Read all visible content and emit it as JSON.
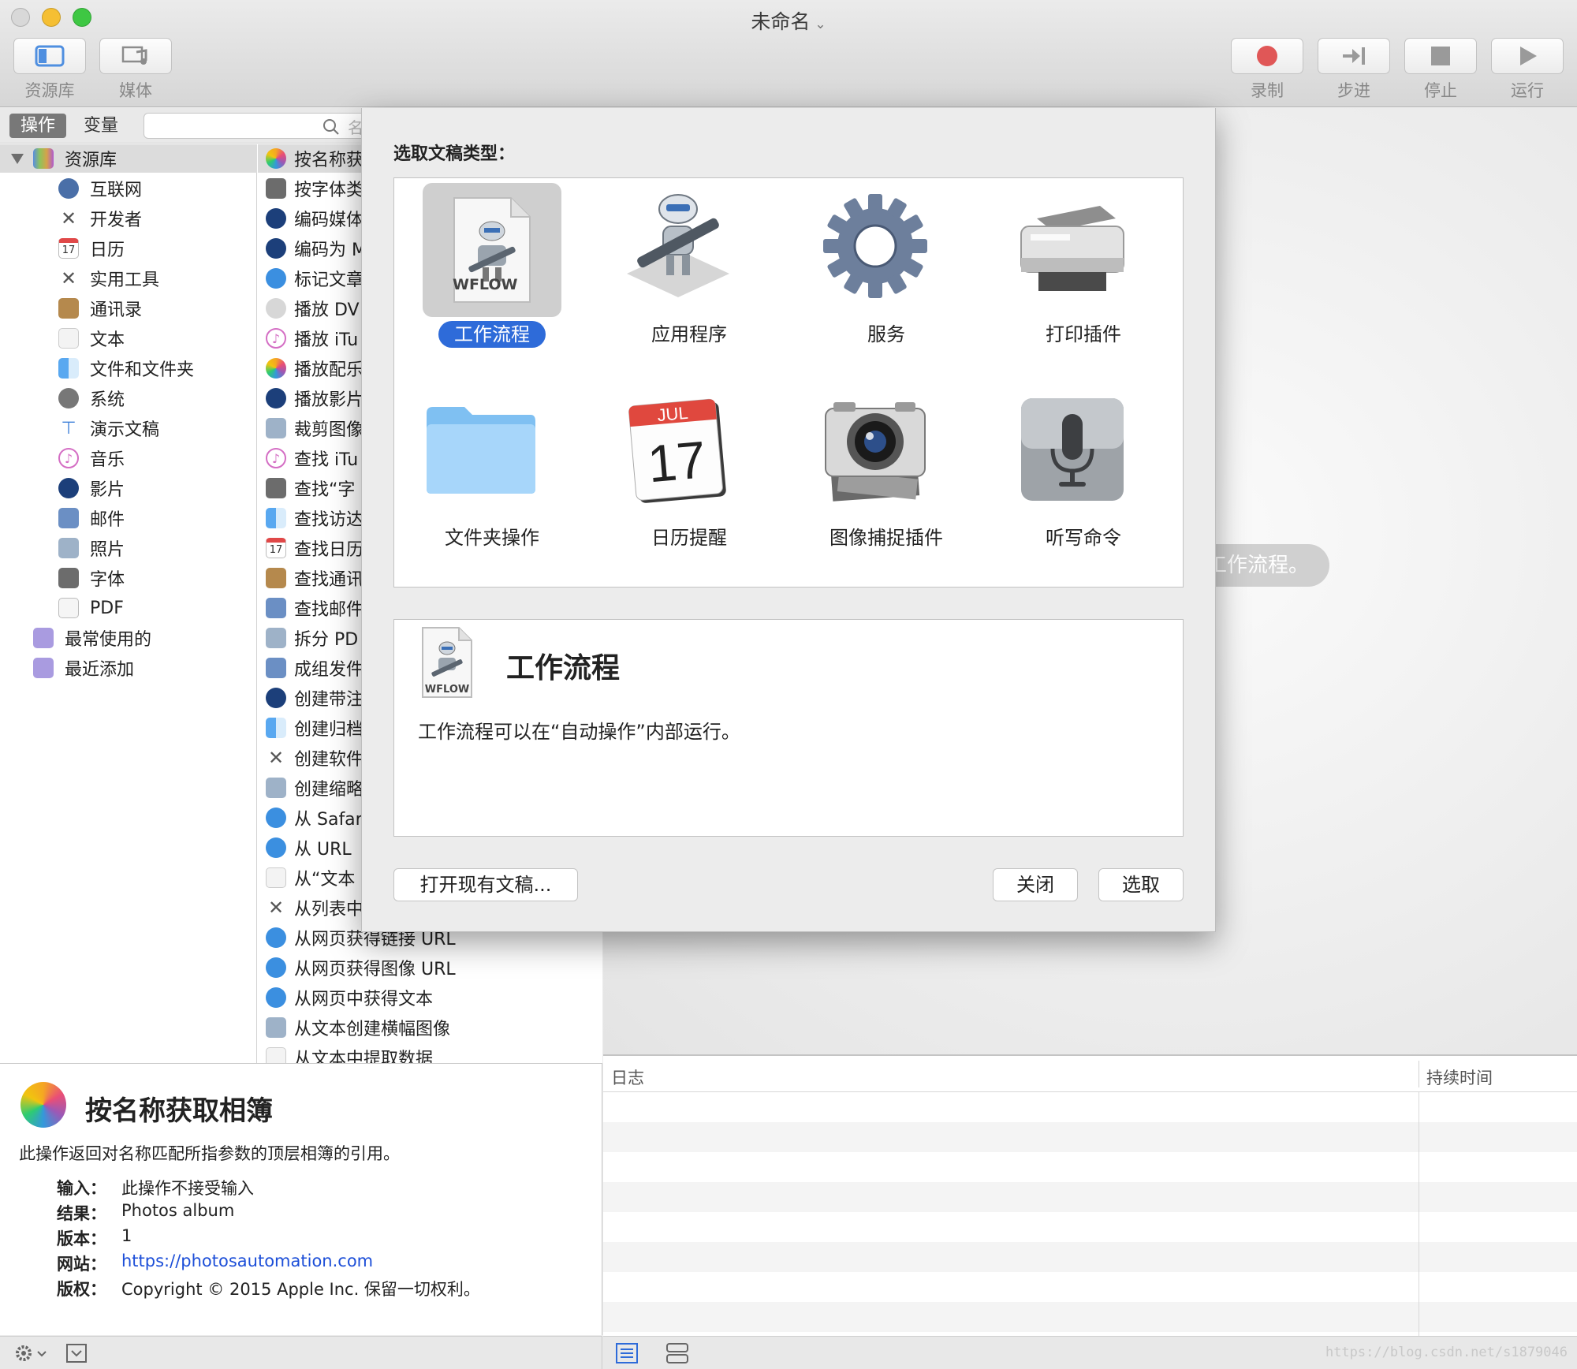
{
  "window": {
    "title": "未命名",
    "chevron": "⌄"
  },
  "toolbar": {
    "left": [
      {
        "label": "资源库",
        "icon": "library-icon"
      },
      {
        "label": "媒体",
        "icon": "media-icon"
      }
    ],
    "right": [
      {
        "label": "录制",
        "icon": "record-icon"
      },
      {
        "label": "步进",
        "icon": "step-icon"
      },
      {
        "label": "停止",
        "icon": "stop-icon"
      },
      {
        "label": "运行",
        "icon": "run-icon"
      }
    ]
  },
  "leftpane": {
    "segments": [
      "操作",
      "变量"
    ],
    "search_placeholder": "名称"
  },
  "library": {
    "root": "资源库",
    "items": [
      "互联网",
      "开发者",
      "日历",
      "实用工具",
      "通讯录",
      "文本",
      "文件和文件夹",
      "系统",
      "演示文稿",
      "音乐",
      "影片",
      "邮件",
      "照片",
      "字体",
      "PDF"
    ],
    "smart_groups": [
      "最常使用的",
      "最近添加"
    ]
  },
  "actions": {
    "items": [
      "按名称获取相簿",
      "按字体类",
      "编码媒体",
      "编码为 M",
      "标记文章",
      "播放 DV",
      "播放 iTu",
      "播放配乐",
      "播放影片",
      "裁剪图像",
      "查找 iTu",
      "查找“字",
      "查找访达",
      "查找日历",
      "查找通讯",
      "查找邮件",
      "拆分 PD",
      "成组发件",
      "创建带注",
      "创建归档",
      "创建软件",
      "创建缩略",
      "从 Safari",
      "从 URL",
      "从“文本",
      "从列表中",
      "从网页获得链接 URL",
      "从网页获得图像 URL",
      "从网页中获得文本",
      "从文本创建横幅图像",
      "从文本中提取数据"
    ]
  },
  "description": {
    "title": "按名称获取相簿",
    "text": "此操作返回对名称匹配所指参数的顶层相簿的引用。",
    "fields": [
      {
        "key": "输入：",
        "value": "此操作不接受输入"
      },
      {
        "key": "结果：",
        "value": "Photos album"
      },
      {
        "key": "版本：",
        "value": "1"
      },
      {
        "key": "网站：",
        "value": "https://photosautomation.com"
      },
      {
        "key": "版权：",
        "value": "Copyright © 2015 Apple Inc. 保留一切权利。"
      }
    ]
  },
  "workflow": {
    "hint": "工作流程。"
  },
  "log": {
    "columns": [
      "日志",
      "持续时间"
    ]
  },
  "sheet": {
    "prompt": "选取文稿类型：",
    "types": [
      {
        "label": "工作流程",
        "icon": "workflow-document-icon",
        "selected": true,
        "badge": "WFLOW"
      },
      {
        "label": "应用程序",
        "icon": "automator-robot-icon",
        "selected": false
      },
      {
        "label": "服务",
        "icon": "gear-icon",
        "selected": false
      },
      {
        "label": "打印插件",
        "icon": "printer-icon",
        "selected": false
      },
      {
        "label": "文件夹操作",
        "icon": "folder-icon",
        "selected": false
      },
      {
        "label": "日历提醒",
        "icon": "calendar-icon",
        "selected": false,
        "month": "JUL",
        "day": "17"
      },
      {
        "label": "图像捕捉插件",
        "icon": "camera-icon",
        "selected": false
      },
      {
        "label": "听写命令",
        "icon": "microphone-icon",
        "selected": false
      }
    ],
    "info_title": "工作流程",
    "info_badge": "WFLOW",
    "info_text": "工作流程可以在“自动操作”内部运行。",
    "btn_open": "打开现有文稿...",
    "btn_close": "关闭",
    "btn_choose": "选取"
  },
  "watermark": "https://blog.csdn.net/s1879046",
  "colors": {
    "accent": "#2e6bd9",
    "link": "#1d4fd8",
    "record": "#e05757"
  }
}
